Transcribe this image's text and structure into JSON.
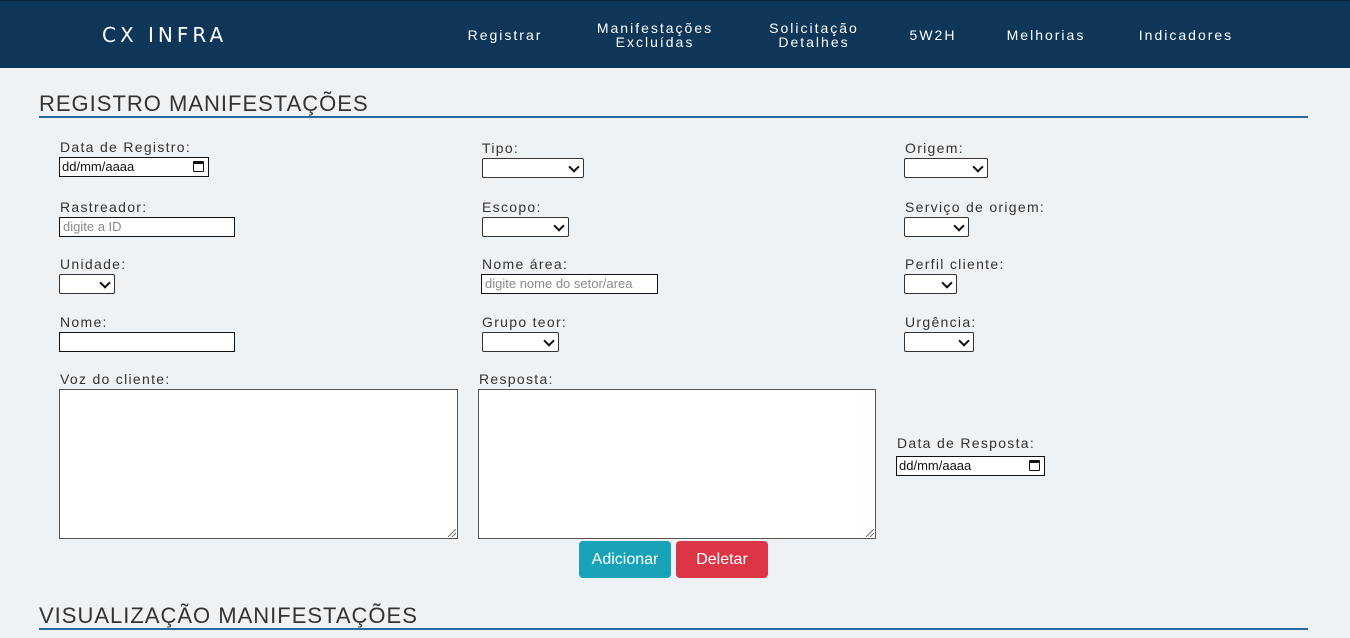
{
  "header": {
    "brand": "CX INFRA",
    "nav": [
      {
        "line1": "Registrar",
        "line2": ""
      },
      {
        "line1": "Manifestações",
        "line2": "Excluídas"
      },
      {
        "line1": "Solicitação",
        "line2": "Detalhes"
      },
      {
        "line1": "5W2H",
        "line2": ""
      },
      {
        "line1": "Melhorias",
        "line2": ""
      },
      {
        "line1": "Indicadores",
        "line2": ""
      }
    ]
  },
  "form": {
    "title": "REGISTRO MANIFESTAÇÕES",
    "fields": {
      "data_registro": {
        "label": "Data de Registro:",
        "value": "dd/mm/aaaa"
      },
      "tipo": {
        "label": "Tipo:",
        "value": ""
      },
      "origem": {
        "label": "Origem:",
        "value": ""
      },
      "rastreador": {
        "label": "Rastreador:",
        "placeholder": "digite a ID"
      },
      "escopo": {
        "label": "Escopo:",
        "value": ""
      },
      "servico_origem": {
        "label": "Serviço de origem:",
        "value": ""
      },
      "unidade": {
        "label": "Unidade:",
        "value": ""
      },
      "nome_area": {
        "label": "Nome área:",
        "placeholder": "digite nome do setor/area"
      },
      "perfil_cliente": {
        "label": "Perfil cliente:",
        "value": ""
      },
      "nome": {
        "label": "Nome:",
        "value": ""
      },
      "grupo_teor": {
        "label": "Grupo teor:",
        "value": ""
      },
      "urgencia": {
        "label": "Urgência:",
        "value": ""
      },
      "voz_cliente": {
        "label": "Voz do cliente:",
        "value": ""
      },
      "resposta": {
        "label": "Resposta:",
        "value": ""
      },
      "data_resposta": {
        "label": "Data de Resposta:",
        "value": "dd/mm/aaaa"
      }
    },
    "buttons": {
      "add": "Adicionar",
      "delete": "Deletar"
    },
    "colors": {
      "add": "#17a2b8",
      "delete": "#dc3545",
      "header": "#0d3658"
    }
  },
  "view": {
    "title": "VISUALIZAÇÃO MANIFESTAÇÕES"
  }
}
